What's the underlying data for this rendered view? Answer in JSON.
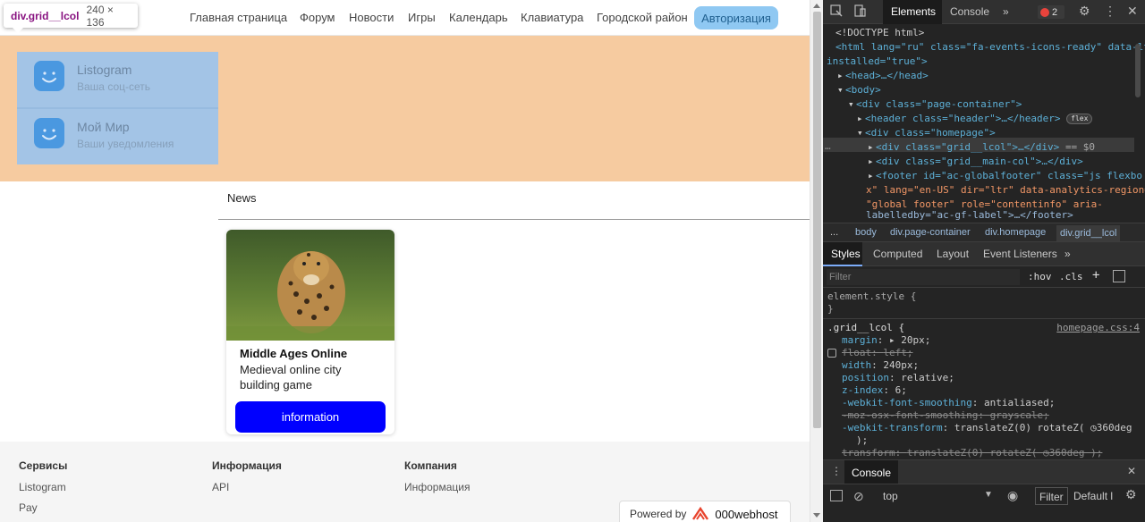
{
  "tooltip": {
    "element": "div.grid__lcol",
    "size": "240 × 136"
  },
  "nav": {
    "items": [
      "Главная страница",
      "Форум",
      "Новости",
      "Игры",
      "Календарь",
      "Клавиатура",
      "Городской район"
    ],
    "auth_label": "Авторизация"
  },
  "apps": [
    {
      "title": "Listogram",
      "subtitle": "Ваша соц-сеть",
      "icon": "smiley-icon"
    },
    {
      "title": "Мой Мир",
      "subtitle": "Ваши уведомления",
      "icon": "smiley-icon"
    }
  ],
  "news": {
    "title": "News",
    "card": {
      "image": "jaguar-photo",
      "title": "Middle Ages Online",
      "description": "Medieval online city building game",
      "button_label": "information"
    }
  },
  "footer": {
    "columns": [
      {
        "heading": "Сервисы",
        "links": [
          "Listogram",
          "Pay"
        ]
      },
      {
        "heading": "Информация",
        "links": [
          "API"
        ]
      },
      {
        "heading": "Компания",
        "links": [
          "Информация"
        ]
      }
    ],
    "powered_label": "Powered by",
    "powered_brand": "000webhost"
  },
  "devtools": {
    "tabs": [
      "Elements",
      "Console",
      "»"
    ],
    "active_tab": "Elements",
    "error_count": "2",
    "dom_lines": {
      "doctype": "<!DOCTYPE html>",
      "html_open_1": "<html lang=\"ru\" class=\"fa-events-icons-ready\" data-lt-",
      "html_open_2": "installed=\"true\">",
      "head": "<head>…</head>",
      "body": "<body>",
      "page_container": "<div class=\"page-container\">",
      "header": "<header class=\"header\">…</header>",
      "header_pill": "flex",
      "homepage": "<div class=\"homepage\">",
      "lcol": "<div class=\"grid__lcol\">…</div>",
      "lcol_suffix": "== $0",
      "maincol": "<div class=\"grid__main-col\">…</div>",
      "footer_1": "<footer id=\"ac-globalfooter\" class=\"js flexbo",
      "footer_2": "x\" lang=\"en-US\" dir=\"ltr\" data-analytics-region=",
      "footer_3": "\"global footer\" role=\"contentinfo\" aria-",
      "footer_4": "labelledby=\"ac-gf-label\">…</footer>"
    },
    "breadcrumbs": [
      "...",
      "body",
      "div.page-container",
      "div.homepage",
      "div.grid__lcol"
    ],
    "sub_tabs": [
      "Styles",
      "Computed",
      "Layout",
      "Event Listeners",
      "»"
    ],
    "filter_placeholder": "Filter",
    "filter_tools": [
      ":hov",
      ".cls",
      "+"
    ],
    "styles": {
      "element_style_open": "element.style {",
      "element_style_close": "}",
      "selector": ".grid__lcol {",
      "source": "homepage.css:4",
      "rules": [
        {
          "prop": "margin",
          "value": "▸ 20px;",
          "struck": false
        },
        {
          "prop": "float",
          "value": "left;",
          "struck": true
        },
        {
          "prop": "width",
          "value": "240px;",
          "struck": false
        },
        {
          "prop": "position",
          "value": "relative;",
          "struck": false
        },
        {
          "prop": "z-index",
          "value": "6;",
          "struck": false
        },
        {
          "prop": "-webkit-font-smoothing",
          "value": "antialiased;",
          "struck": false
        },
        {
          "prop": "-moz-osx-font-smoothing",
          "value": "grayscale;",
          "struck": true
        },
        {
          "prop": "-webkit-transform",
          "value": "translateZ(0) rotateZ( ◷360deg",
          "struck": false
        },
        {
          "prop": "",
          "value": ");",
          "struck": false
        },
        {
          "prop": "transform",
          "value": "translateZ(0) rotateZ( ◷360deg );",
          "struck": true
        }
      ]
    },
    "console": {
      "tab_label": "Console",
      "context": "top",
      "filter_label": "Filter",
      "levels_label": "Default l"
    }
  }
}
